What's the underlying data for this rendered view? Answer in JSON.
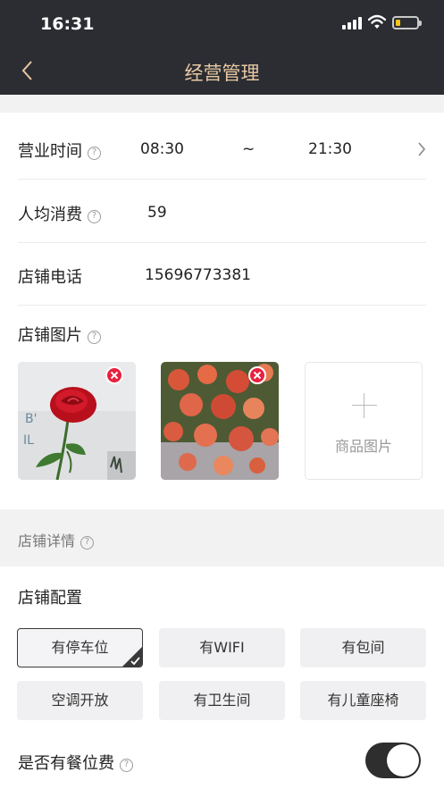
{
  "status_bar": {
    "time": "16:31"
  },
  "nav": {
    "title": "经营管理"
  },
  "business_hours": {
    "label": "营业时间",
    "start": "08:30",
    "separator": "~",
    "end": "21:30"
  },
  "avg_spend": {
    "label": "人均消费",
    "value": "59"
  },
  "phone": {
    "label": "店铺电话",
    "value": "15696773381"
  },
  "photos": {
    "label": "店铺图片",
    "add_label": "商品图片"
  },
  "details_section": {
    "label": "店铺详情"
  },
  "config": {
    "title": "店铺配置",
    "options": [
      {
        "label": "有停车位",
        "selected": true
      },
      {
        "label": "有WIFI",
        "selected": false
      },
      {
        "label": "有包间",
        "selected": false
      },
      {
        "label": "空调开放",
        "selected": false
      },
      {
        "label": "有卫生间",
        "selected": false
      },
      {
        "label": "有儿童座椅",
        "selected": false
      }
    ]
  },
  "seat_fee": {
    "label": "是否有餐位费",
    "enabled": true
  },
  "colors": {
    "nav_bg": "#2b2d33",
    "title": "#e9c9a3",
    "delete_badge": "#e8213f"
  }
}
